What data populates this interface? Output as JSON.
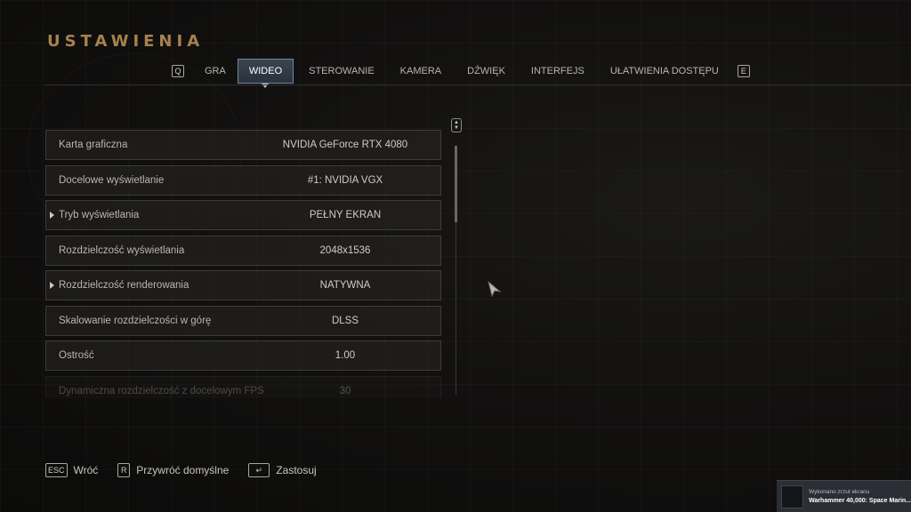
{
  "page": {
    "title": "USTAWIENIA"
  },
  "tabs": {
    "prev_key": "Q",
    "next_key": "E",
    "items": [
      {
        "label": "GRA",
        "active": false
      },
      {
        "label": "WIDEO",
        "active": true
      },
      {
        "label": "STEROWANIE",
        "active": false
      },
      {
        "label": "KAMERA",
        "active": false
      },
      {
        "label": "DŹWIĘK",
        "active": false
      },
      {
        "label": "INTERFEJS",
        "active": false
      },
      {
        "label": "UŁATWIENIA DOSTĘPU",
        "active": false
      }
    ]
  },
  "settings": [
    {
      "label": "Karta graficzna",
      "value": "NVIDIA GeForce RTX 4080",
      "expandable": false
    },
    {
      "label": "Docelowe wyświetlanie",
      "value": "#1: NVIDIA VGX",
      "expandable": false
    },
    {
      "label": "Tryb wyświetlania",
      "value": "PEŁNY EKRAN",
      "expandable": true
    },
    {
      "label": "Rozdzielczość wyświetlania",
      "value": "2048x1536",
      "expandable": false
    },
    {
      "label": "Rozdzielczość renderowania",
      "value": "NATYWNA",
      "expandable": true
    },
    {
      "label": "Skalowanie rozdzielczości w górę",
      "value": "DLSS",
      "expandable": false
    },
    {
      "label": "Ostrość",
      "value": "1.00",
      "expandable": false
    },
    {
      "label": "Dynamiczna rozdzielczość z docelowym FPS",
      "value": "30",
      "expandable": false
    }
  ],
  "scrollbar": {
    "position_fraction": 0.0,
    "visible_fraction": 0.3
  },
  "footer": {
    "back": {
      "key": "ESC",
      "label": "Wróć"
    },
    "reset": {
      "key": "R",
      "label": "Przywróć domyślne"
    },
    "apply": {
      "key": "↵",
      "label": "Zastosuj"
    }
  },
  "notification": {
    "line1": "Wykonano zrzut ekranu",
    "line2": "Warhammer 40,000: Space Marin..."
  },
  "colors": {
    "title": "#a8804c",
    "active_tab_bg": "#323b45",
    "active_tab_border": "#6f86a0",
    "row_border": "#3e3c38"
  }
}
